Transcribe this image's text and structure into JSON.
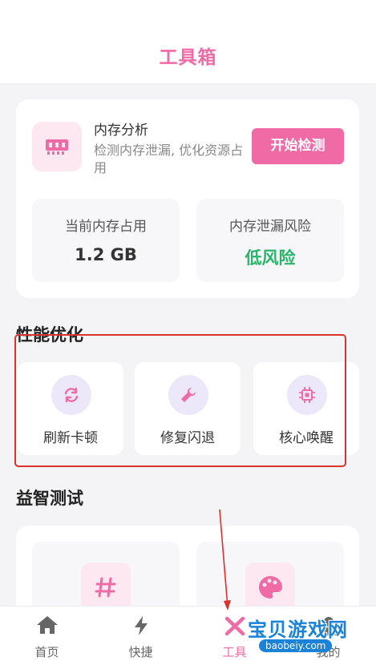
{
  "header": {
    "title": "工具箱"
  },
  "memory": {
    "title": "内存分析",
    "description": "检测内存泄漏, 优化资源占用",
    "start_button": "开始检测",
    "usage_label": "当前内存占用",
    "usage_value": "1.2 GB",
    "leak_label": "内存泄漏风险",
    "leak_value": "低风险",
    "leak_color": "#28b66a"
  },
  "performance": {
    "title": "性能优化",
    "tools": [
      {
        "label": "刷新卡顿",
        "icon": "refresh-icon"
      },
      {
        "label": "修复闪退",
        "icon": "wrench-icon"
      },
      {
        "label": "核心唤醒",
        "icon": "chip-icon"
      }
    ]
  },
  "puzzle": {
    "title": "益智测试",
    "tiles": [
      {
        "icon": "hash-icon"
      },
      {
        "icon": "palette-icon"
      }
    ]
  },
  "tabbar": {
    "tabs": [
      {
        "label": "首页",
        "icon": "home-icon"
      },
      {
        "label": "快捷",
        "icon": "bolt-icon"
      },
      {
        "label": "工具",
        "icon": "tools-icon",
        "active": true
      },
      {
        "label": "我的",
        "icon": "user-icon"
      }
    ]
  },
  "watermark": {
    "text": "宝贝游戏网",
    "url": "baobeiy.com"
  },
  "colors": {
    "accent": "#f06aa6",
    "icon_bg_purple": "#ece8fa",
    "icon_bg_pink": "#fde7f0"
  }
}
